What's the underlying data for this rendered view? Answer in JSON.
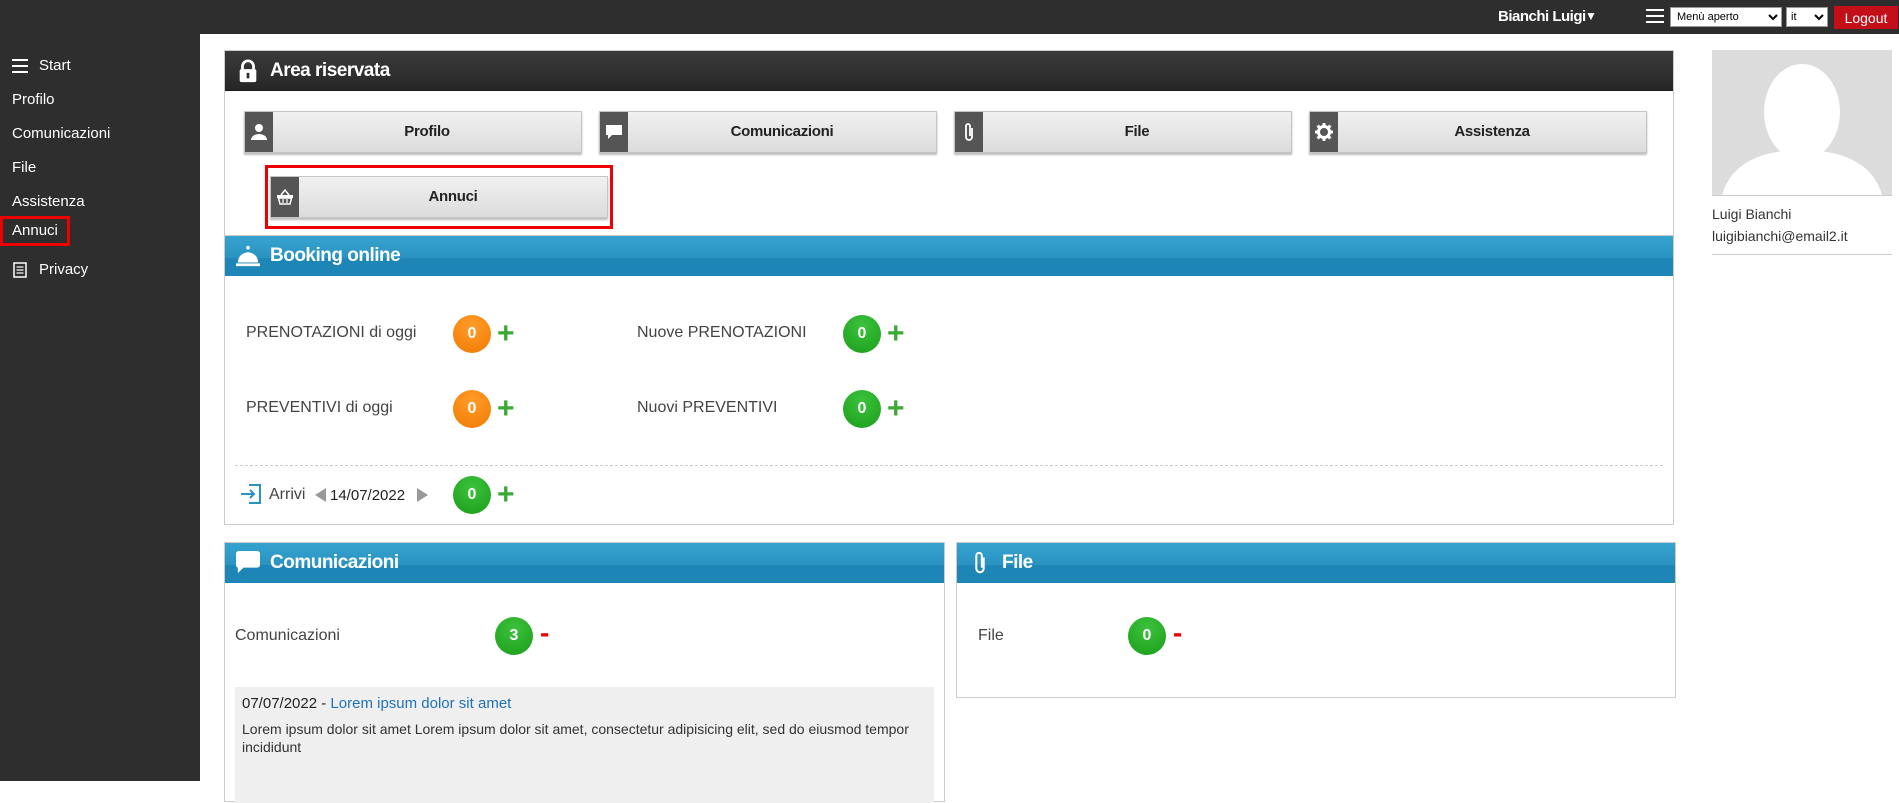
{
  "topbar": {
    "user_name": "Bianchi Luigi",
    "menu_select": {
      "selected": "Menù aperto"
    },
    "lang_select": {
      "selected": "it"
    },
    "logout_label": "Logout"
  },
  "sidebar": {
    "items": [
      {
        "label": "Start",
        "icon": "hamburger-icon"
      },
      {
        "label": "Profilo"
      },
      {
        "label": "Comunicazioni"
      },
      {
        "label": "File"
      },
      {
        "label": "Assistenza"
      },
      {
        "label": "Annuci",
        "active": true
      },
      {
        "label": "Privacy",
        "icon": "document-icon"
      }
    ]
  },
  "area_riservata": {
    "title": "Area riservata",
    "tiles": [
      {
        "label": "Profilo",
        "icon": "user-icon"
      },
      {
        "label": "Comunicazioni",
        "icon": "speech-bubble-icon"
      },
      {
        "label": "File",
        "icon": "paperclip-icon"
      },
      {
        "label": "Assistenza",
        "icon": "gear-icon"
      },
      {
        "label": "Annuci",
        "icon": "basket-icon"
      }
    ]
  },
  "booking": {
    "title": "Booking online",
    "prenotazioni_oggi": {
      "label": "PRENOTAZIONI di oggi",
      "count": "0"
    },
    "nuove_prenotazioni": {
      "label": "Nuove PRENOTAZIONI",
      "count": "0"
    },
    "preventivi_oggi": {
      "label": "PREVENTIVI di oggi",
      "count": "0"
    },
    "nuovi_preventivi": {
      "label": "Nuovi PREVENTIVI",
      "count": "0"
    },
    "arrivi": {
      "label": "Arrivi",
      "date": "14/07/2022",
      "count": "0"
    }
  },
  "comunicazioni": {
    "title": "Comunicazioni",
    "label": "Comunicazioni",
    "count": "3",
    "news": [
      {
        "date": "07/07/2022",
        "separator": " - ",
        "title": "Lorem ipsum dolor sit amet",
        "body": "Lorem ipsum dolor sit amet Lorem ipsum dolor sit amet, consectetur adipisicing elit, sed do eiusmod tempor incididunt"
      }
    ]
  },
  "file_panel": {
    "title": "File",
    "label": "File",
    "count": "0"
  },
  "profile": {
    "name": "Luigi Bianchi",
    "email": "luigibianchi@email2.it"
  },
  "colors": {
    "topbar": "#2e2e2e",
    "accent_red": "#c30f17",
    "panel_blue": "#2a93c1",
    "badge_orange": "#f58a0b",
    "badge_green": "#22a522",
    "plus_green": "#3aa935"
  }
}
